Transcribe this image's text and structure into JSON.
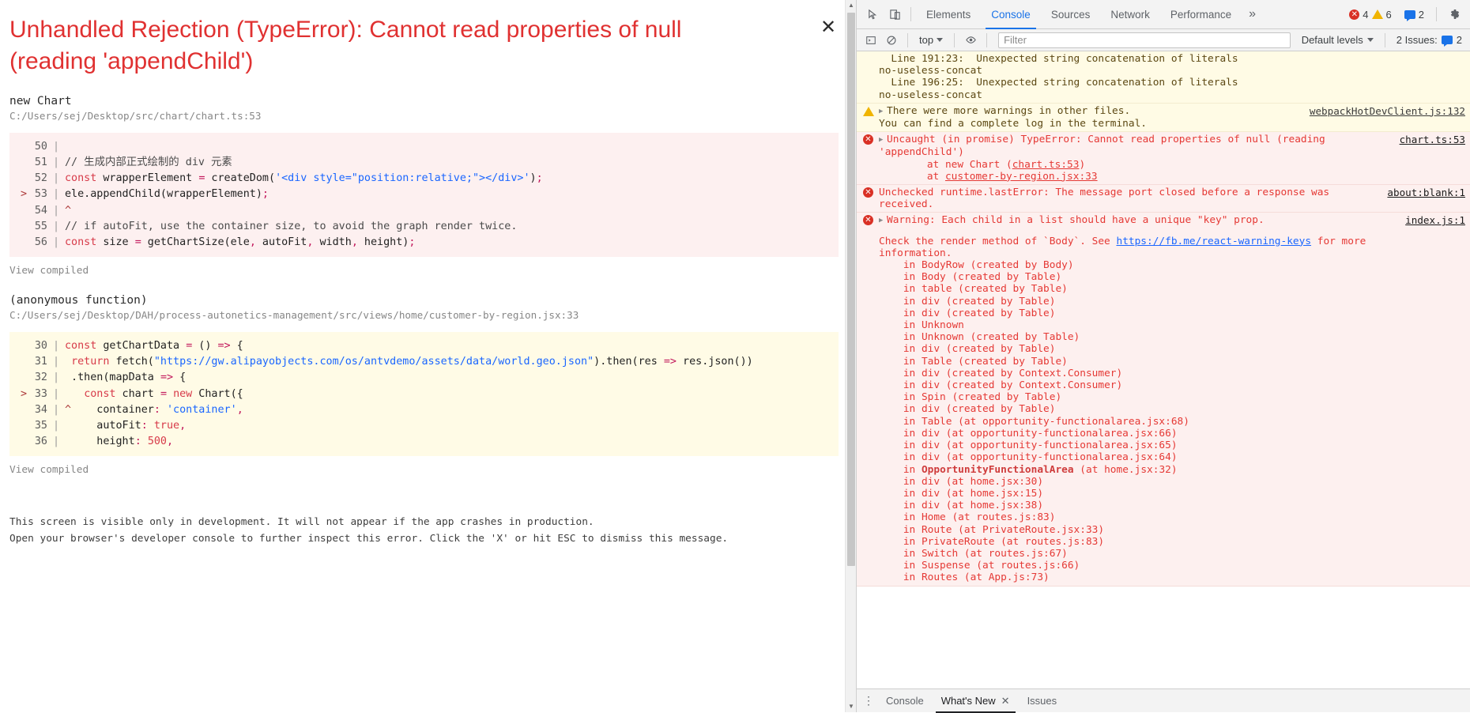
{
  "overlay": {
    "title": "Unhandled Rejection (TypeError): Cannot read properties of null (reading 'appendChild')",
    "close_label": "✕",
    "frames": [
      {
        "fn": "new Chart",
        "loc": "C:/Users/sej/Desktop/src/chart/chart.ts:53",
        "view_compiled": "View compiled",
        "highlight": "red",
        "lines": [
          {
            "n": "50",
            "mark": "",
            "parts": []
          },
          {
            "n": "51",
            "mark": "",
            "parts": [
              {
                "t": "com",
                "s": "// 生成内部正式绘制的 div 元素"
              }
            ]
          },
          {
            "n": "52",
            "mark": "",
            "parts": [
              {
                "t": "kw",
                "s": "const"
              },
              {
                "t": "plain",
                "s": " wrapperElement "
              },
              {
                "t": "op",
                "s": "="
              },
              {
                "t": "plain",
                "s": " createDom("
              },
              {
                "t": "str",
                "s": "'<div style=\"position:relative;\"></div>'"
              },
              {
                "t": "plain",
                "s": ")"
              },
              {
                "t": "op",
                "s": ";"
              }
            ]
          },
          {
            "n": "53",
            "mark": ">",
            "parts": [
              {
                "t": "plain",
                "s": "ele.appendChild(wrapperElement)"
              },
              {
                "t": "op",
                "s": ";"
              }
            ]
          },
          {
            "n": "54",
            "mark": "",
            "parts": [
              {
                "t": "caret",
                "s": "^"
              }
            ]
          },
          {
            "n": "55",
            "mark": "",
            "parts": [
              {
                "t": "com",
                "s": "// if autoFit, use the container size, to avoid the graph render twice."
              }
            ]
          },
          {
            "n": "56",
            "mark": "",
            "parts": [
              {
                "t": "kw",
                "s": "const"
              },
              {
                "t": "plain",
                "s": " size "
              },
              {
                "t": "op",
                "s": "="
              },
              {
                "t": "plain",
                "s": " getChartSize(ele"
              },
              {
                "t": "op",
                "s": ","
              },
              {
                "t": "plain",
                "s": " autoFit"
              },
              {
                "t": "op",
                "s": ","
              },
              {
                "t": "plain",
                "s": " width"
              },
              {
                "t": "op",
                "s": ","
              },
              {
                "t": "plain",
                "s": " height)"
              },
              {
                "t": "op",
                "s": ";"
              }
            ]
          }
        ]
      },
      {
        "fn": "(anonymous function)",
        "loc": "C:/Users/sej/Desktop/DAH/process-autonetics-management/src/views/home/customer-by-region.jsx:33",
        "view_compiled": "View compiled",
        "highlight": "yellow",
        "lines": [
          {
            "n": "30",
            "mark": "",
            "parts": [
              {
                "t": "kw",
                "s": "const"
              },
              {
                "t": "plain",
                "s": " getChartData "
              },
              {
                "t": "op",
                "s": "="
              },
              {
                "t": "plain",
                "s": " () "
              },
              {
                "t": "op",
                "s": "=>"
              },
              {
                "t": "plain",
                "s": " {"
              }
            ]
          },
          {
            "n": "31",
            "mark": "",
            "parts": [
              {
                "t": "plain",
                "s": " "
              },
              {
                "t": "kw",
                "s": "return"
              },
              {
                "t": "plain",
                "s": " fetch("
              },
              {
                "t": "str",
                "s": "\"https://gw.alipayobjects.com/os/antvdemo/assets/data/world.geo.json\""
              },
              {
                "t": "plain",
                "s": ").then(res "
              },
              {
                "t": "op",
                "s": "=>"
              },
              {
                "t": "plain",
                "s": " res.json())"
              }
            ]
          },
          {
            "n": "32",
            "mark": "",
            "parts": [
              {
                "t": "plain",
                "s": " .then(mapData "
              },
              {
                "t": "op",
                "s": "=>"
              },
              {
                "t": "plain",
                "s": " {"
              }
            ]
          },
          {
            "n": "33",
            "mark": ">",
            "parts": [
              {
                "t": "plain",
                "s": "   "
              },
              {
                "t": "kw",
                "s": "const"
              },
              {
                "t": "plain",
                "s": " chart "
              },
              {
                "t": "op",
                "s": "="
              },
              {
                "t": "plain",
                "s": " "
              },
              {
                "t": "kw",
                "s": "new"
              },
              {
                "t": "plain",
                "s": " Chart({"
              }
            ]
          },
          {
            "n": "34",
            "mark": "",
            "parts": [
              {
                "t": "caret",
                "s": "^"
              },
              {
                "t": "plain",
                "s": "    container"
              },
              {
                "t": "op",
                "s": ":"
              },
              {
                "t": "plain",
                "s": " "
              },
              {
                "t": "str",
                "s": "'container'"
              },
              {
                "t": "op",
                "s": ","
              }
            ]
          },
          {
            "n": "35",
            "mark": "",
            "parts": [
              {
                "t": "plain",
                "s": "     autoFit"
              },
              {
                "t": "op",
                "s": ":"
              },
              {
                "t": "plain",
                "s": " "
              },
              {
                "t": "num",
                "s": "true"
              },
              {
                "t": "op",
                "s": ","
              }
            ]
          },
          {
            "n": "36",
            "mark": "",
            "parts": [
              {
                "t": "plain",
                "s": "     height"
              },
              {
                "t": "op",
                "s": ":"
              },
              {
                "t": "plain",
                "s": " "
              },
              {
                "t": "num",
                "s": "500"
              },
              {
                "t": "op",
                "s": ","
              }
            ]
          }
        ]
      }
    ],
    "footnotes": [
      "This screen is visible only in development. It will not appear if the app crashes in production.",
      "Open your browser's developer console to further inspect this error.  Click the 'X' or hit ESC to dismiss this message."
    ]
  },
  "devtools": {
    "toolbar": {
      "inspect_icon": "inspect-element-icon",
      "device_icon": "device-toolbar-icon",
      "tabs": [
        {
          "label": "Elements",
          "active": false
        },
        {
          "label": "Console",
          "active": true
        },
        {
          "label": "Sources",
          "active": false
        },
        {
          "label": "Network",
          "active": false
        },
        {
          "label": "Performance",
          "active": false
        }
      ],
      "more_label": "»",
      "error_count": "4",
      "warning_count": "6",
      "message_count": "2",
      "settings_icon": "gear-icon"
    },
    "subbar": {
      "execute_icon": "execute-sidebar-icon",
      "clear_icon": "clear-console-icon",
      "context": "top",
      "eye_icon": "live-expression-icon",
      "filter_placeholder": "Filter",
      "filter_value": "",
      "levels_label": "Default levels",
      "issues_label": "2 Issues:",
      "issues_count": "2"
    },
    "messages": [
      {
        "kind": "warn",
        "icon": "",
        "expander": "",
        "link": "",
        "lines": [
          "  Line 191:23:  Unexpected string concatenation of literals",
          "no-useless-concat",
          "  Line 196:25:  Unexpected string concatenation of literals",
          "no-useless-concat"
        ]
      },
      {
        "kind": "warn",
        "icon": "warning-icon",
        "expander": "▶",
        "link": "webpackHotDevClient.js:132",
        "lines": [
          "There were more warnings in other files.",
          "You can find a complete log in the terminal."
        ]
      },
      {
        "kind": "error",
        "icon": "error-icon",
        "expander": "▶",
        "link": "chart.ts:53",
        "lines": [
          "Uncaught (in promise) TypeError: Cannot read properties of null (reading",
          "'appendChild')"
        ],
        "stack": [
          {
            "pre": "    at new Chart (",
            "link": "chart.ts:53",
            "post": ")"
          },
          {
            "pre": "    at ",
            "link": "customer-by-region.jsx:33",
            "post": ""
          }
        ]
      },
      {
        "kind": "error",
        "icon": "error-icon",
        "expander": "",
        "link": "about:blank:1",
        "lines": [
          "Unchecked runtime.lastError: The message port closed before a response was",
          "received."
        ]
      },
      {
        "kind": "error",
        "icon": "error-icon",
        "expander": "▶",
        "link": "index.js:1",
        "lines": [
          "Warning: Each child in a list should have a unique \"key\" prop."
        ],
        "body_pre": "Check the render method of `Body`. See ",
        "body_link": "https://fb.me/react-warning-keys",
        "body_post": " for more\ninformation.",
        "component_stack": [
          {
            "text": "    in BodyRow (created by Body)",
            "hl": ""
          },
          {
            "text": "    in Body (created by Table)",
            "hl": ""
          },
          {
            "text": "    in table (created by Table)",
            "hl": ""
          },
          {
            "text": "    in div (created by Table)",
            "hl": ""
          },
          {
            "text": "    in div (created by Table)",
            "hl": ""
          },
          {
            "text": "    in Unknown",
            "hl": ""
          },
          {
            "text": "    in Unknown (created by Table)",
            "hl": ""
          },
          {
            "text": "    in div (created by Table)",
            "hl": ""
          },
          {
            "text": "    in Table (created by Table)",
            "hl": ""
          },
          {
            "text": "    in div (created by Context.Consumer)",
            "hl": ""
          },
          {
            "text": "    in div (created by Context.Consumer)",
            "hl": ""
          },
          {
            "text": "    in Spin (created by Table)",
            "hl": ""
          },
          {
            "text": "    in div (created by Table)",
            "hl": ""
          },
          {
            "text": "    in Table (at opportunity-functionalarea.jsx:68)",
            "hl": ""
          },
          {
            "text": "    in div (at opportunity-functionalarea.jsx:66)",
            "hl": ""
          },
          {
            "text": "    in div (at opportunity-functionalarea.jsx:65)",
            "hl": ""
          },
          {
            "text": "    in div (at opportunity-functionalarea.jsx:64)",
            "hl": ""
          },
          {
            "text": "    in OpportunityFunctionalArea (at home.jsx:32)",
            "hl": "yes"
          },
          {
            "text": "    in div (at home.jsx:30)",
            "hl": ""
          },
          {
            "text": "    in div (at home.jsx:15)",
            "hl": ""
          },
          {
            "text": "    in div (at home.jsx:38)",
            "hl": ""
          },
          {
            "text": "    in Home (at routes.js:83)",
            "hl": ""
          },
          {
            "text": "    in Route (at PrivateRoute.jsx:33)",
            "hl": ""
          },
          {
            "text": "    in PrivateRoute (at routes.js:83)",
            "hl": ""
          },
          {
            "text": "    in Switch (at routes.js:67)",
            "hl": ""
          },
          {
            "text": "    in Suspense (at routes.js:66)",
            "hl": ""
          },
          {
            "text": "    in Routes (at App.js:73)",
            "hl": ""
          }
        ]
      }
    ],
    "drawer": {
      "menu_icon": "more-options-icon",
      "tabs": [
        {
          "label": "Console",
          "active": false,
          "closable": false
        },
        {
          "label": "What's New",
          "active": true,
          "closable": true
        },
        {
          "label": "Issues",
          "active": false,
          "closable": false
        }
      ],
      "close_label": "✕"
    }
  }
}
